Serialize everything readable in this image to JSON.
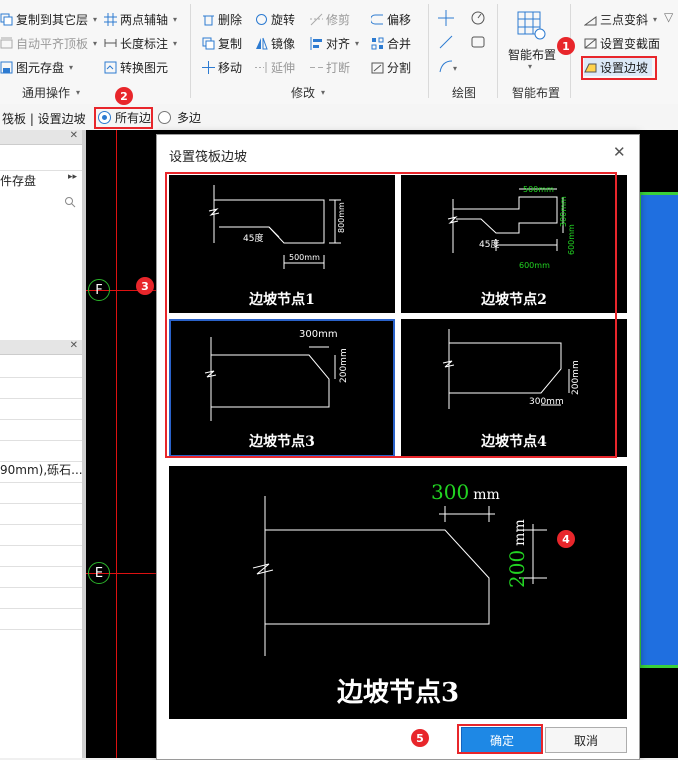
{
  "ribbon": {
    "col1": [
      "复制到其它层",
      "自动平齐顶板",
      "图元存盘"
    ],
    "col2": [
      "两点辅轴",
      "长度标注",
      "转换图元"
    ],
    "col3": [
      "删除",
      "复制",
      "移动"
    ],
    "col4": [
      "旋转",
      "镜像",
      "延伸"
    ],
    "col5": [
      "修剪",
      "对齐",
      "打断"
    ],
    "col6": [
      "偏移",
      "合并",
      "分割"
    ],
    "smart_layout": "智能布置",
    "col_right": [
      "三点变斜",
      "设置变截面",
      "设置边坡"
    ],
    "groups": {
      "general": "通用操作",
      "modify": "修改",
      "draw": "绘图",
      "smart": "智能布置"
    }
  },
  "optbar": {
    "breadcrumb": "筏板 | 设置边坡",
    "option_all": "所有边",
    "option_multi": "多边"
  },
  "left_panel": {
    "top_item": "件存盘",
    "rows": [
      "",
      "",
      "",
      "",
      "",
      "90mm),砾石...",
      "",
      "",
      "",
      "",
      "",
      "",
      ""
    ]
  },
  "canvas": {
    "axis_f": "F",
    "axis_e": "E"
  },
  "dialog": {
    "title": "设置筏板边坡",
    "nodes": [
      {
        "label": "边坡节点1",
        "dims": {
          "angle": "45度",
          "bottom": "500mm",
          "height": "800mm"
        }
      },
      {
        "label": "边坡节点2",
        "dims": {
          "angle": "45度",
          "top": "500mm",
          "bottom": "600mm",
          "h1": "300mm",
          "h2": "600mm"
        }
      },
      {
        "label": "边坡节点3",
        "dims": {
          "top": "300mm",
          "height": "200mm"
        }
      },
      {
        "label": "边坡节点4",
        "dims": {
          "bottom": "300mm",
          "height": "200mm"
        }
      }
    ],
    "preview": {
      "label": "边坡节点3",
      "w_value": "300",
      "w_unit": "mm",
      "h_value": "200",
      "h_unit": "mm"
    },
    "ok": "确定",
    "cancel": "取消"
  },
  "callouts": [
    "1",
    "2",
    "3",
    "4",
    "5"
  ],
  "colors": {
    "red": "#e8262b",
    "dim_green": "#22d422",
    "accent": "#1e88e5",
    "selected_border": "#2a62c9"
  }
}
